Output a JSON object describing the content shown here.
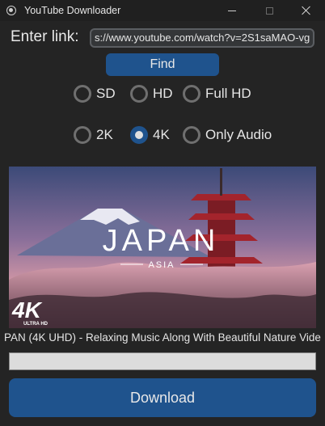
{
  "window": {
    "title": "YouTube Downloader",
    "icon": "app-icon"
  },
  "link": {
    "label": "Enter link:",
    "value": "s://www.youtube.com/watch?v=2S1saMAO-vg"
  },
  "find_label": "Find",
  "quality_options": [
    {
      "label": "SD",
      "selected": false
    },
    {
      "label": "HD",
      "selected": false
    },
    {
      "label": "Full HD",
      "selected": false
    },
    {
      "label": "2K",
      "selected": false
    },
    {
      "label": "4K",
      "selected": true
    },
    {
      "label": "Only Audio",
      "selected": false
    }
  ],
  "thumbnail": {
    "title": "JAPAN",
    "subtitle": "ASIA",
    "badge_main": "4K",
    "badge_sub": "ULTRA HD"
  },
  "video_title": "PAN (4K UHD) - Relaxing Music Along With Beautiful Nature Vide",
  "progress": 0,
  "download_label": "Download",
  "colors": {
    "accent": "#1f538d",
    "background": "#242424"
  }
}
